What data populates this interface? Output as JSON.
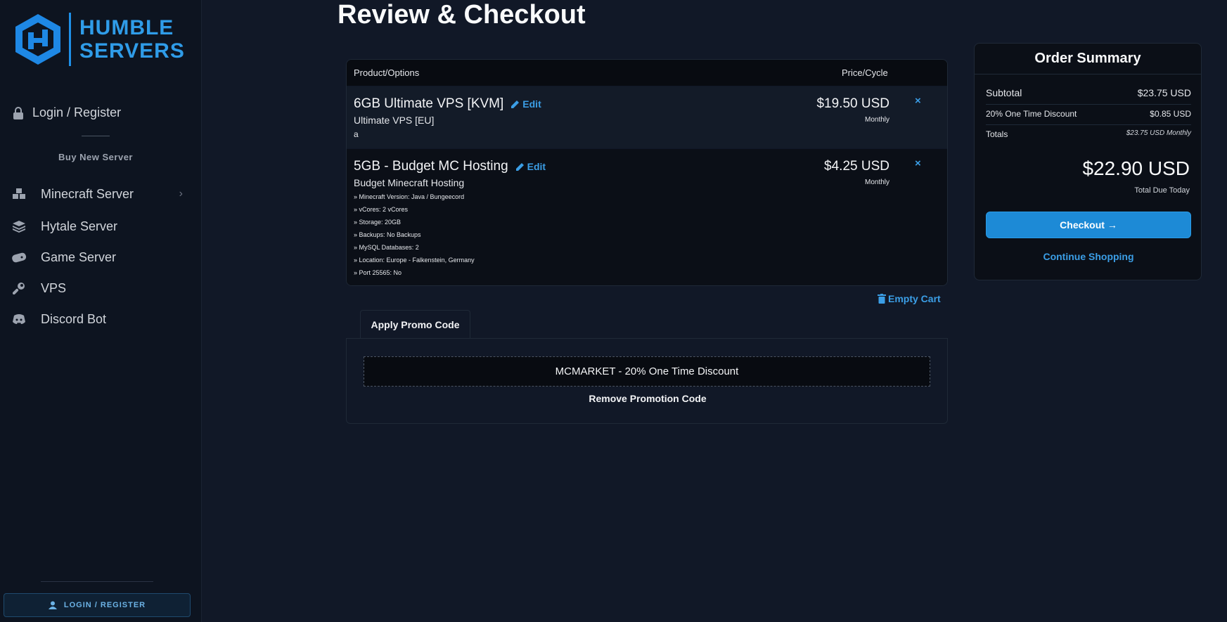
{
  "sidebar": {
    "logo_line1": "HUMBLE",
    "logo_line2": "SERVERS",
    "login_label": "Login / Register",
    "section_label": "Buy New Server",
    "items": [
      {
        "label": "Minecraft Server",
        "icon": "minecraft-blocks-icon",
        "has_submenu": true
      },
      {
        "label": "Hytale Server",
        "icon": "stack-icon"
      },
      {
        "label": "Game Server",
        "icon": "gamepad-icon"
      },
      {
        "label": "VPS",
        "icon": "wrench-icon"
      },
      {
        "label": "Discord Bot",
        "icon": "discord-icon"
      }
    ],
    "bottom_login_label": "LOGIN / REGISTER"
  },
  "main": {
    "title": "Review & Checkout",
    "cart": {
      "col_product": "Product/Options",
      "col_price": "Price/Cycle",
      "edit_label": "Edit",
      "remove_symbol": "×",
      "items": [
        {
          "name": "6GB Ultimate VPS [KVM]",
          "group": "Ultimate VPS [EU]",
          "note": "a",
          "price": "$19.50 USD",
          "cycle": "Monthly"
        },
        {
          "name": "5GB - Budget MC Hosting",
          "group": "Budget Minecraft Hosting",
          "price": "$4.25 USD",
          "cycle": "Monthly",
          "options": [
            "» Minecraft Version: Java / Bungeecord",
            "» vCores: 2 vCores",
            "» Storage: 20GB",
            "» Backups: No Backups",
            "» MySQL Databases: 2",
            "» Location: Europe - Falkenstein, Germany",
            "» Port 25565: No"
          ]
        }
      ],
      "empty_cart_label": "Empty Cart"
    },
    "promo": {
      "tab_label": "Apply Promo Code",
      "applied_code": "MCMARKET - 20% One Time Discount",
      "remove_label": "Remove Promotion Code"
    }
  },
  "summary": {
    "title": "Order Summary",
    "subtotal_label": "Subtotal",
    "subtotal_value": "$23.75 USD",
    "discount_label": "20% One Time Discount",
    "discount_value": "$0.85 USD",
    "totals_label": "Totals",
    "totals_value": "$23.75 USD Monthly",
    "total_due": "$22.90 USD",
    "total_due_label": "Total Due Today",
    "checkout_label": "Checkout →",
    "continue_label": "Continue Shopping"
  },
  "colors": {
    "accent": "#1d8ad6",
    "link": "#3b9ee6",
    "background": "#111827"
  }
}
